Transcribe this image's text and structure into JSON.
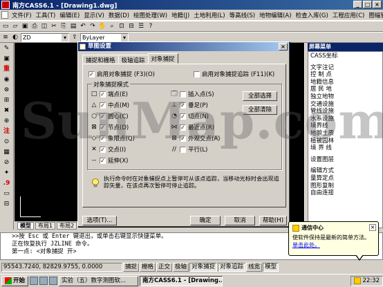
{
  "window": {
    "title": "南方CASS6.1 - [Drawing1.dwg]"
  },
  "menu": [
    "文件(F)",
    "工具(T)",
    "编辑(E)",
    "显示(V)",
    "数据(D)",
    "绘图处理(W)",
    "地籍(J)",
    "土地利用(L)",
    "等高线(S)",
    "地物编辑(A)",
    "检查入库(G)",
    "工程应用(C)",
    "图幅管理(M)"
  ],
  "toolbar": {
    "layer_combo": "ZD",
    "color_combo": "ByLayer"
  },
  "left_tools": [
    "✎",
    "▣",
    "重",
    "◉",
    "⊗",
    "⊞",
    "✖",
    "⊕",
    "注",
    "⊙",
    "▦",
    "⊘",
    "✦",
    ".9",
    "▭",
    "⊟"
  ],
  "canvas": {
    "tabs": [
      "模型",
      "布局1",
      "布局2"
    ]
  },
  "right_panel": {
    "title": "屏幕菜单",
    "items": [
      "CASS坐标",
      "",
      "文字注记",
      "控 制 点",
      "地籍信息",
      "居 民 地",
      "独立地物",
      "交通设施",
      "管线设施",
      "水系设施",
      "境界线",
      "地貌土质",
      "植被园林",
      "境 界 线",
      "",
      "设置图层",
      "",
      "编辑方式",
      "量算定点",
      "图形复制",
      "自由连接"
    ]
  },
  "dialog": {
    "title": "草图设置",
    "tabs": [
      "捕捉和栅格",
      "极轴追踪",
      "对象捕捉"
    ],
    "selected_tab": "对象捕捉",
    "enable_osnap": "启用对象捕捉 (F3)(O)",
    "enable_tracking": "启用对象捕捉追踪 (F11)(K)",
    "group_label": "对象捕捉模式",
    "modes_left": [
      {
        "symbol": "□",
        "label": "端点(E)",
        "checked": true
      },
      {
        "symbol": "△",
        "label": "中点(M)",
        "checked": true
      },
      {
        "symbol": "○",
        "label": "圆心(C)",
        "checked": true
      },
      {
        "symbol": "⊠",
        "label": "节点(D)",
        "checked": true
      },
      {
        "symbol": "◇",
        "label": "象限点(Q)",
        "checked": true
      },
      {
        "symbol": "✕",
        "label": "交点(I)",
        "checked": true
      },
      {
        "symbol": "--",
        "label": "延伸(X)",
        "checked": true
      }
    ],
    "modes_right": [
      {
        "symbol": "🗔",
        "label": "插入点(S)",
        "checked": false
      },
      {
        "symbol": "⊥",
        "label": "垂足(P)",
        "checked": true
      },
      {
        "symbol": "◔",
        "label": "切点(N)",
        "checked": true
      },
      {
        "symbol": "⋈",
        "label": "最近点(R)",
        "checked": true
      },
      {
        "symbol": "⊠",
        "label": "外观交点(A)",
        "checked": true
      },
      {
        "symbol": "//",
        "label": "平行(L)",
        "checked": false
      }
    ],
    "select_all": "全部选择",
    "clear_all": "全部清除",
    "info": "执行命令时在对象捕捉点上暂停可从该点追踪，当移动光标时会出现追踪矢量，在该点再次暂停可停止追踪。",
    "options_button": "选项(T)...",
    "ok_button": "确定",
    "cancel_button": "取消",
    "help_button": "帮助(H)"
  },
  "command": {
    "line1": ">>按 Esc 或 Enter 键退出，或单击右键显示快捷菜单。",
    "line2": "正在恢复执行 JZLINE 命令。",
    "line3": "第一点: <对象捕捉 开>"
  },
  "status": {
    "coords": "95543.7240, 82829.9755, 0.0000",
    "buttons": [
      "捕捉",
      "栅格",
      "正交",
      "极轴",
      "对象捕捉",
      "对象追踪",
      "线宽",
      "模型"
    ],
    "active": [
      "对象捕捉",
      "对象追踪",
      "模型"
    ]
  },
  "taskbar": {
    "start": "开始",
    "tasks": [
      "实验（五）数字测图软...",
      "南方CASS6.1 - [Drawing..."
    ],
    "active_task": "南方CASS6.1 - [Drawing...",
    "clock": "22:32"
  },
  "balloon": {
    "title": "通信中心",
    "text": "使软件保持是最新的简单方法。",
    "link": "单击此处。"
  },
  "watermark": "SunMap.com"
}
